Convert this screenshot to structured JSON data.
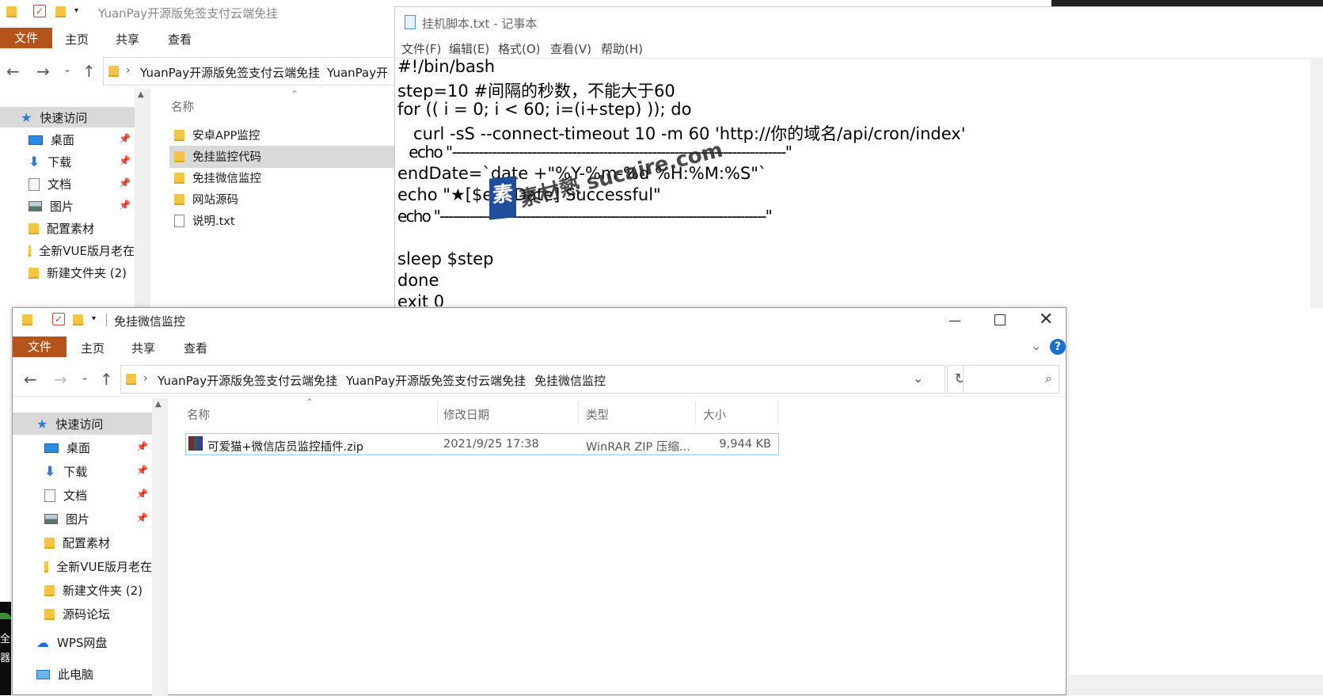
{
  "back_explorer": {
    "title": "YuanPay开源版免签支付云端免挂",
    "tabs": [
      "文件",
      "主页",
      "共享",
      "查看"
    ],
    "crumbs": [
      "YuanPay开源版免签支付云端免挂",
      "YuanPay开"
    ],
    "name_header": "名称",
    "sidebar": [
      "快速访问",
      "桌面",
      "下载",
      "文档",
      "图片",
      "配置素材",
      "全新VUE版月老在",
      "新建文件夹 (2)"
    ],
    "files": [
      "安卓APP监控",
      "免挂监控代码",
      "免挂微信监控",
      "网站源码",
      "说明.txt"
    ]
  },
  "notepad": {
    "title": "挂机脚本.txt - 记事本",
    "menu": [
      "文件(F)",
      "编辑(E)",
      "格式(O)",
      "查看(V)",
      "帮助(H)"
    ],
    "lines": [
      "#!/bin/bash",
      "step=10 #间隔的秒数，不能大于60",
      "for (( i = 0; i < 60; i=(i+step) )); do",
      "   curl -sS --connect-timeout 10 -m 60 'http://你的域名/api/cron/index'",
      "   echo \"---------------------------------------------------------------------------\"",
      "endDate=`date +\"%Y-%m-%d %H:%M:%S\"`",
      "echo \"★[$endDate] Successful\"",
      "echo \"----------------------------------------------------------------------------\"",
      "",
      "sleep $step",
      "done",
      "exit 0"
    ],
    "watermark": "素材熱 sucaire.com"
  },
  "front_explorer": {
    "title": "免挂微信监控",
    "tabs": [
      "文件",
      "主页",
      "共享",
      "查看"
    ],
    "crumbs": [
      "YuanPay开源版免签支付云端免挂",
      "YuanPay开源版免签支付云端免挂",
      "免挂微信监控"
    ],
    "headers": {
      "name": "名称",
      "date": "修改日期",
      "type": "类型",
      "size": "大小"
    },
    "sidebar": [
      "快速访问",
      "桌面",
      "下载",
      "文档",
      "图片",
      "配置素材",
      "全新VUE版月老在",
      "新建文件夹 (2)",
      "源码论坛",
      "WPS网盘",
      "此电脑"
    ],
    "file": {
      "name": "可爱猫+微信店员监控插件.zip",
      "date": "2021/9/25 17:38",
      "type": "WinRAR ZIP 压缩...",
      "size": "9,944 KB"
    }
  },
  "left_strip": [
    "全",
    "器"
  ]
}
